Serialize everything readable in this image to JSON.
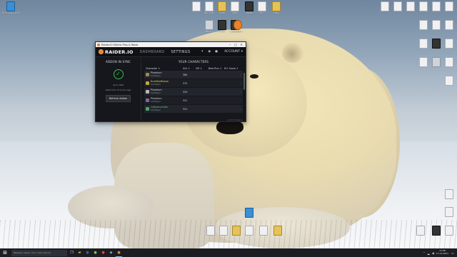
{
  "window": {
    "title": "Raider.IO Mythic Plus & Raids",
    "minimize_icon": "–",
    "maximize_icon": "□",
    "close_icon": "✕"
  },
  "nav": {
    "brand": "RAIDER.IO",
    "tabs": [
      {
        "label": "DASHBOARD",
        "active": true
      },
      {
        "label": "SETTINGS",
        "active": false
      }
    ],
    "icons": [
      "twitter-icon",
      "discord-icon",
      "patreon-icon"
    ],
    "account_label": "ACCOUNT ▾"
  },
  "addon": {
    "title": "ADDON IN SYNC",
    "status": "up to date",
    "time": "Data from 13 hours ago",
    "refresh_label": "Refresh Addon"
  },
  "characters": {
    "title": "YOUR CHARACTERS",
    "headers": [
      "Character ↕",
      "iLVL ↕",
      "CM ↕",
      "Best Run ↕",
      "M+ Score ↕"
    ],
    "rows": [
      {
        "name": "Plumbum",
        "realm": "Soulflayer",
        "ilvl": "380",
        "cm": "",
        "best": "",
        "score": "",
        "arrow": "›"
      },
      {
        "name": "Бсалбумбакаа",
        "realm": "Soulflayer",
        "ilvl": "372",
        "cm": "",
        "best": "",
        "score": "",
        "arrow": "›"
      },
      {
        "name": "Plumbum",
        "realm": "Soulflayer",
        "ilvl": "329",
        "cm": "",
        "best": "",
        "score": "",
        "arrow": "›"
      },
      {
        "name": "Plumbum",
        "realm": "Soulflayer",
        "ilvl": "321",
        "cm": "",
        "best": "",
        "score": "",
        "arrow": "›"
      },
      {
        "name": "Субмасштаба",
        "realm": "Soulflayer",
        "ilvl": "321",
        "cm": "",
        "best": "",
        "score": "",
        "arrow": "›"
      }
    ],
    "footer": "v1.9.0 @ raider.io"
  },
  "desktop": {
    "left_icon_label": "Этот компьютер",
    "top_icons": [
      "",
      "Dev-code",
      "WoW",
      "Data",
      "WoW",
      "Doc",
      "Data"
    ],
    "mid_icons": [
      "Облако",
      "Steam",
      "Battle.net",
      "Raider.io"
    ]
  },
  "taskbar": {
    "start_icon": "⊞",
    "search_placeholder": "Введите здесь текст для поиска",
    "clock_time": "17:08",
    "clock_date": "17.11.2021"
  }
}
